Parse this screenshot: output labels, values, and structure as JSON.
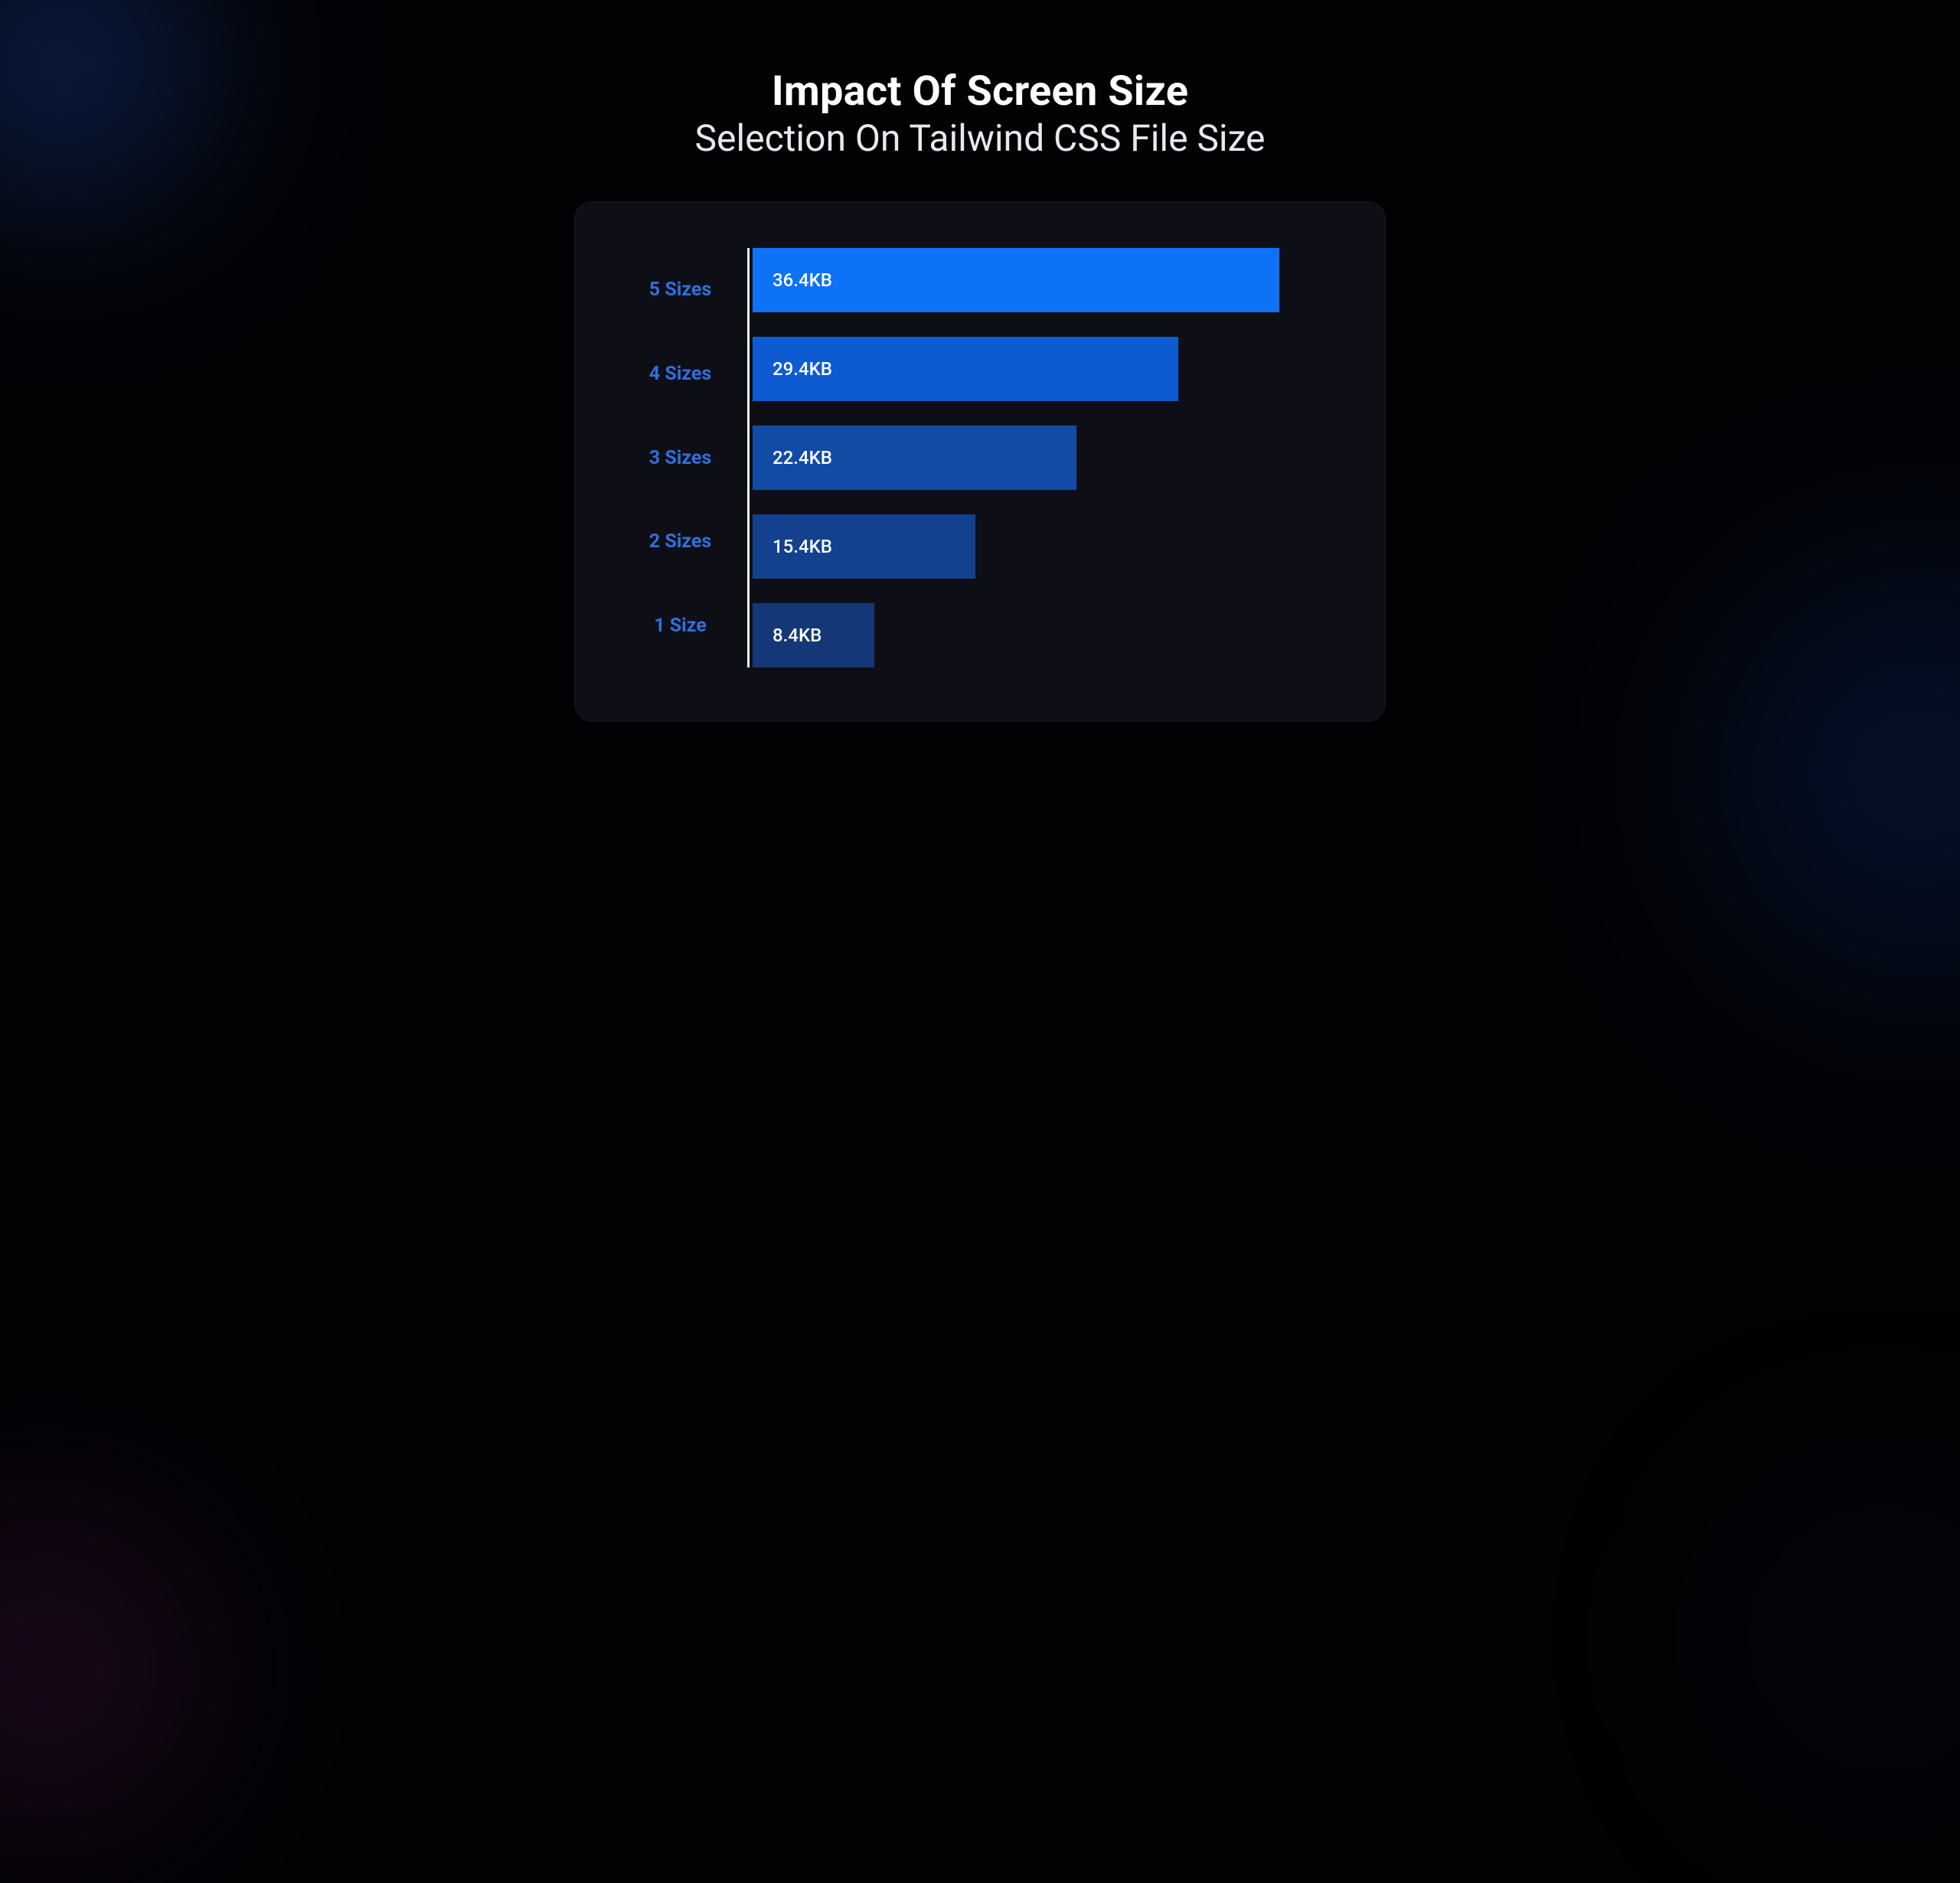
{
  "header": {
    "title": "Impact Of Screen Size",
    "subtitle": "Selection On Tailwind CSS File Size"
  },
  "chart_data": {
    "type": "bar",
    "orientation": "horizontal",
    "title": "Impact Of Screen Size Selection On Tailwind CSS File Size",
    "xlabel": "",
    "ylabel": "",
    "categories": [
      "5 Sizes",
      "4 Sizes",
      "3 Sizes",
      "2 Sizes",
      "1 Size"
    ],
    "values": [
      36.4,
      29.4,
      22.4,
      15.4,
      8.4
    ],
    "value_labels": [
      "36.4KB",
      "29.4KB",
      "22.4KB",
      "15.4KB",
      "8.4KB"
    ],
    "unit": "KB",
    "bar_colors": [
      "#0d72f6",
      "#0e5bd1",
      "#124ba6",
      "#13418e",
      "#143877"
    ],
    "xlim": [
      0,
      40
    ]
  }
}
